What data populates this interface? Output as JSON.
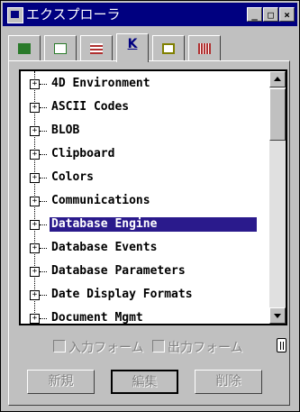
{
  "window": {
    "title": "エクスプローラ"
  },
  "title_buttons": {
    "minimize": "_",
    "maximize": "□",
    "close": "×"
  },
  "tabs": [
    {
      "icon": "list-icon",
      "color": "#2a7a2a"
    },
    {
      "icon": "form-icon",
      "color": "#2a7a2a"
    },
    {
      "icon": "table-icon",
      "color": "#b03030"
    },
    {
      "label": "K",
      "icon": "constants-icon",
      "active": true
    },
    {
      "icon": "picture-icon",
      "color": "#808000"
    },
    {
      "icon": "tools-icon",
      "color": "#b03030"
    }
  ],
  "tree": {
    "items": [
      {
        "label": "4D Environment",
        "expander": "+"
      },
      {
        "label": "ASCII Codes",
        "expander": "+"
      },
      {
        "label": "BLOB",
        "expander": "+"
      },
      {
        "label": "Clipboard",
        "expander": "+"
      },
      {
        "label": "Colors",
        "expander": "+"
      },
      {
        "label": "Communications",
        "expander": "+"
      },
      {
        "label": "Database Engine",
        "expander": "+",
        "selected": true
      },
      {
        "label": "Database Events",
        "expander": "+"
      },
      {
        "label": "Database Parameters",
        "expander": "+"
      },
      {
        "label": "Date Display Formats",
        "expander": "+"
      },
      {
        "label": "Document Mgmt",
        "expander": "+"
      }
    ],
    "selected_color": "#2a1a8c"
  },
  "options": {
    "input_form": "入力フォーム",
    "output_form": "出力フォーム"
  },
  "buttons": {
    "new": "新規",
    "edit": "編集",
    "delete": "削除"
  }
}
